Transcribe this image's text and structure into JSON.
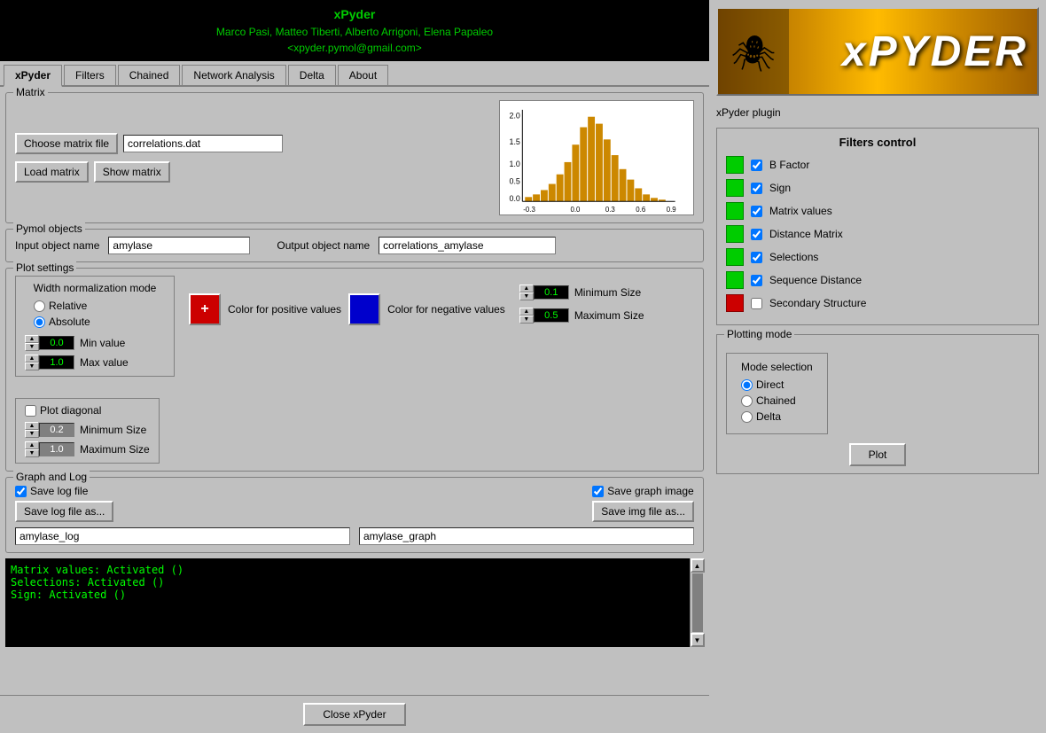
{
  "header": {
    "app_name": "xPyder",
    "authors": "Marco Pasi, Matteo Tiberti, Alberto Arrigoni, Elena Papaleo",
    "email": "<xpyder.pymol@gmail.com>"
  },
  "tabs": [
    {
      "label": "xPyder",
      "active": true
    },
    {
      "label": "Filters",
      "active": false
    },
    {
      "label": "Chained",
      "active": false
    },
    {
      "label": "Network Analysis",
      "active": false
    },
    {
      "label": "Delta",
      "active": false
    },
    {
      "label": "About",
      "active": false
    }
  ],
  "matrix": {
    "group_title": "Matrix",
    "choose_btn": "Choose matrix file",
    "file_input": "correlations.dat",
    "load_btn": "Load matrix",
    "show_btn": "Show matrix"
  },
  "pymol": {
    "group_title": "Pymol objects",
    "input_label": "Input object name",
    "input_value": "amylase",
    "output_label": "Output object name",
    "output_value": "correlations_amylase"
  },
  "plot_settings": {
    "group_title": "Plot settings",
    "width_norm_title": "Width normalization mode",
    "relative_label": "Relative",
    "absolute_label": "Absolute",
    "color_pos_label": "Color for positive values",
    "color_neg_label": "Color for negative values",
    "color_pos_symbol": "+",
    "min_val_label": "Min value",
    "max_val_label": "Max value",
    "min_val": "0.0",
    "max_val": "1.0",
    "min_size_label": "Minimum Size",
    "max_size_label": "Maximum Size",
    "min_size": "0.1",
    "max_size": "0.5",
    "plot_diag_label": "Plot diagonal",
    "diag_min_label": "Minimum Size",
    "diag_max_label": "Maximum Size",
    "diag_min_val": "0.2",
    "diag_max_val": "1.0"
  },
  "graph_log": {
    "group_title": "Graph and Log",
    "save_log_label": "Save log file",
    "save_img_label": "Save graph image",
    "save_log_btn": "Save log file as...",
    "save_img_btn": "Save img file as...",
    "log_filename": "amylase_log",
    "img_filename": "amylase_graph"
  },
  "console": {
    "lines": [
      "Matrix values: Activated ()",
      "Selections: Activated ()",
      "Sign: Activated ()"
    ]
  },
  "bottom": {
    "close_btn": "Close xPyder"
  },
  "right_panel": {
    "plugin_label": "xPyder plugin",
    "filters_control_title": "Filters control",
    "filters": [
      {
        "label": "B Factor",
        "checked": true,
        "color": "green"
      },
      {
        "label": "Sign",
        "checked": true,
        "color": "green"
      },
      {
        "label": "Matrix values",
        "checked": true,
        "color": "green"
      },
      {
        "label": "Distance Matrix",
        "checked": true,
        "color": "green"
      },
      {
        "label": "Selections",
        "checked": true,
        "color": "green"
      },
      {
        "label": "Sequence Distance",
        "checked": true,
        "color": "green"
      },
      {
        "label": "Secondary Structure",
        "checked": false,
        "color": "red"
      }
    ],
    "plotting_mode_title": "Plotting mode",
    "mode_selection_title": "Mode selection",
    "modes": [
      {
        "label": "Direct",
        "selected": true
      },
      {
        "label": "Chained",
        "selected": false
      },
      {
        "label": "Delta",
        "selected": false
      }
    ],
    "plot_btn": "Plot"
  }
}
